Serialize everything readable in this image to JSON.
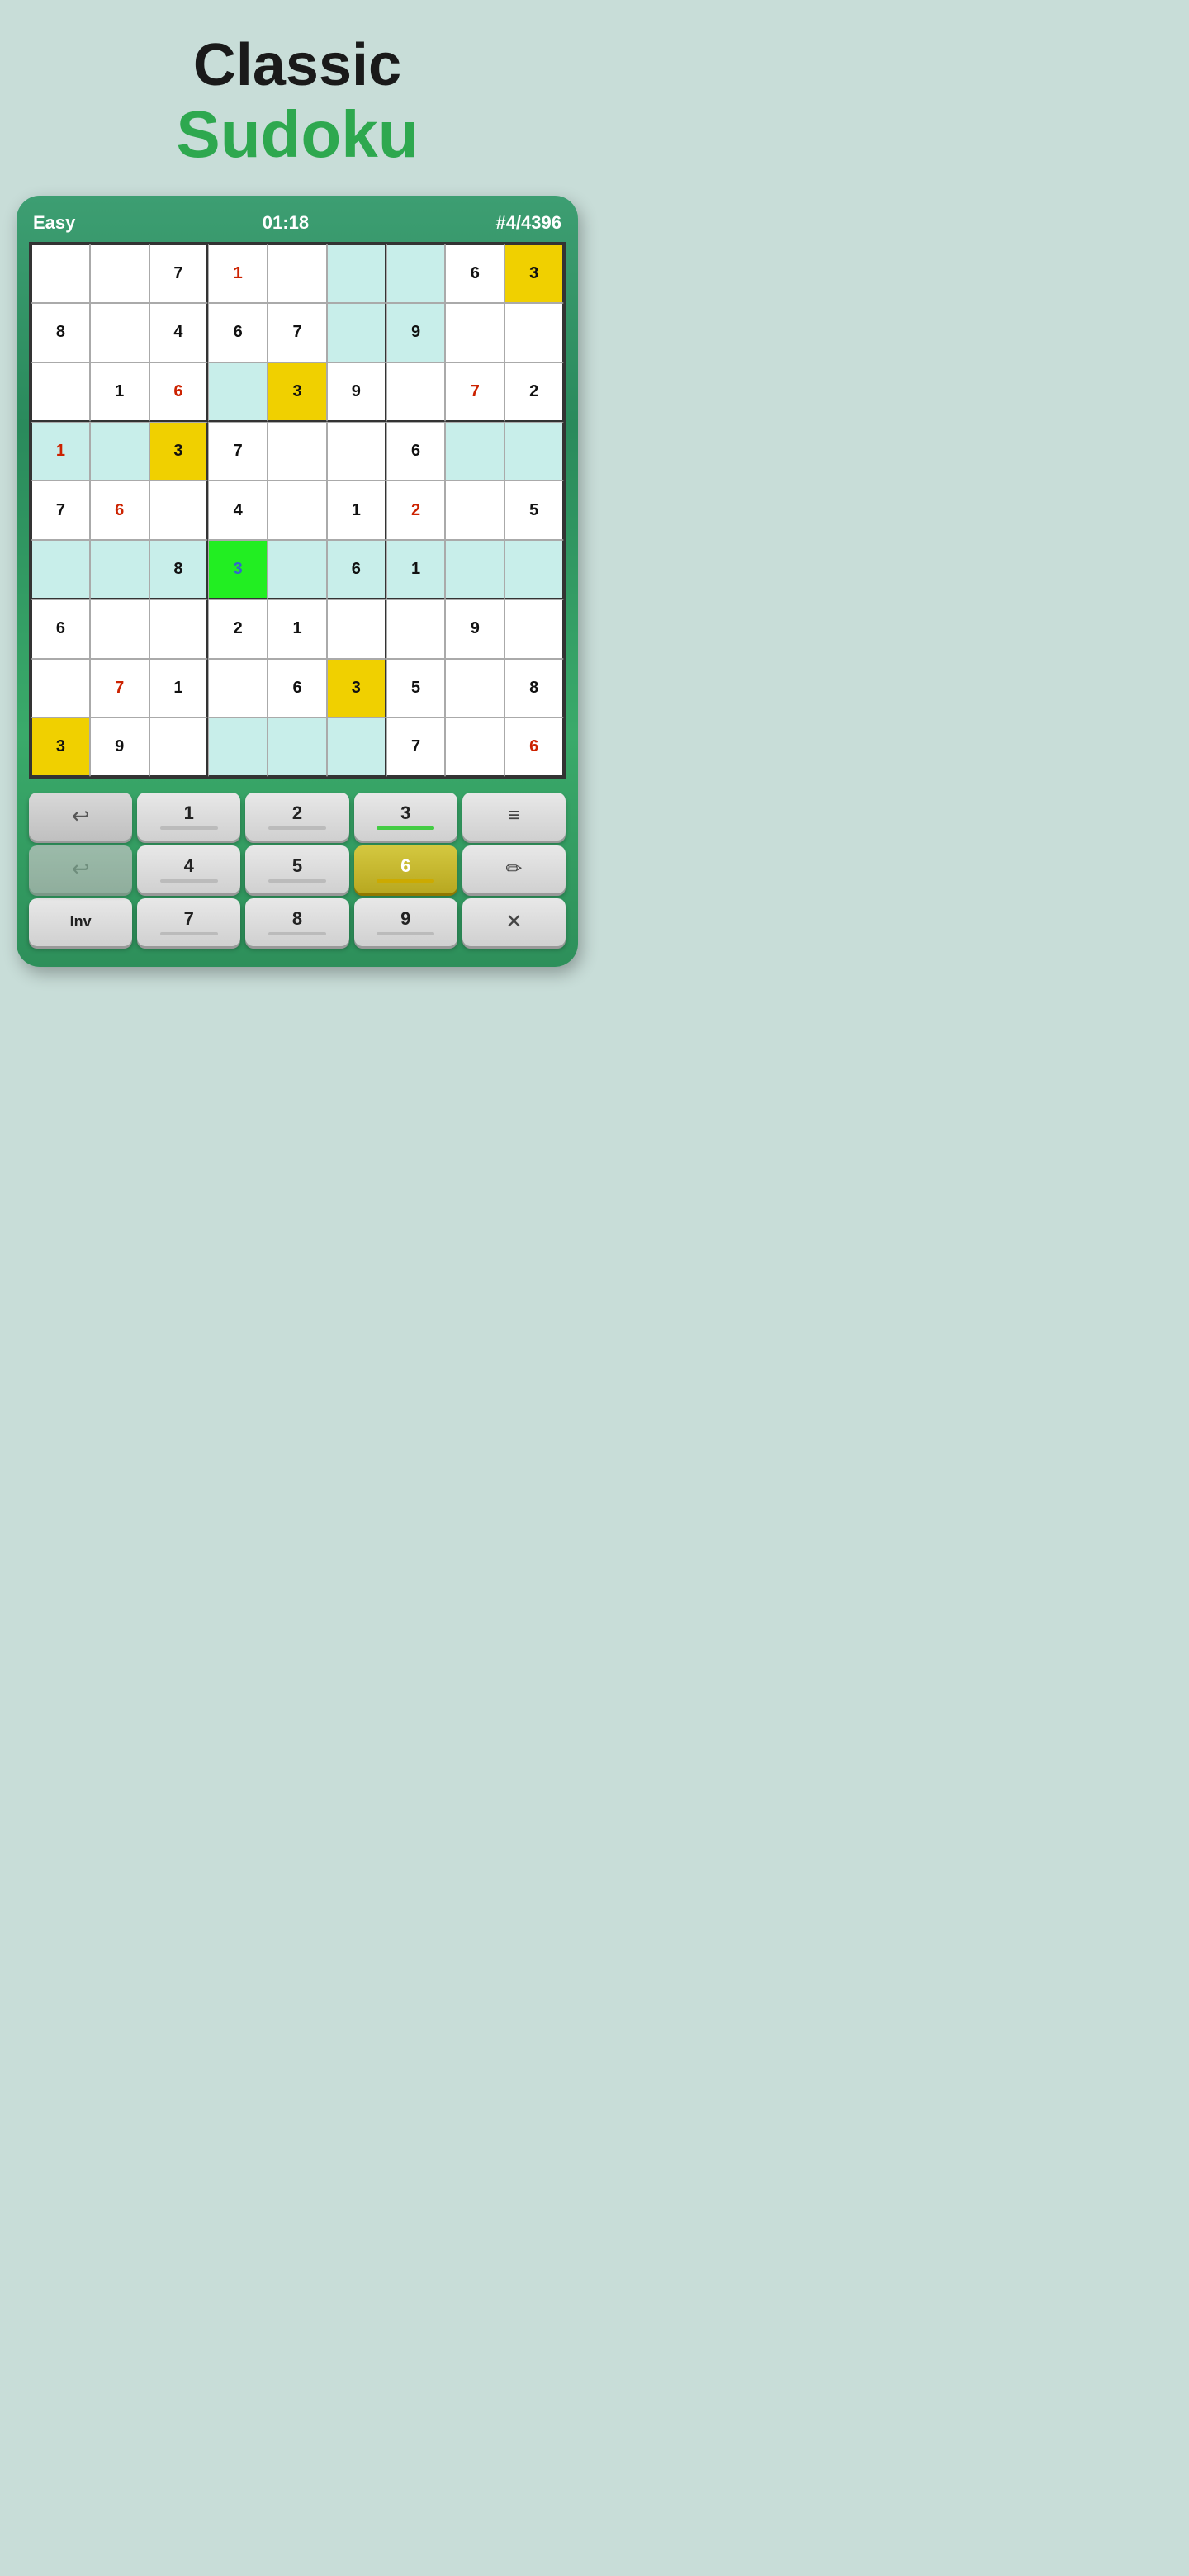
{
  "title": {
    "classic": "Classic",
    "sudoku": "Sudoku"
  },
  "header": {
    "difficulty": "Easy",
    "timer": "01:18",
    "puzzle_id": "#4/4396"
  },
  "grid": {
    "rows": [
      [
        {
          "val": "",
          "style": "white-bg",
          "color": "black"
        },
        {
          "val": "",
          "style": "white-bg",
          "color": "black"
        },
        {
          "val": "7",
          "style": "white-bg",
          "color": "black"
        },
        {
          "val": "1",
          "style": "white-bg",
          "color": "red"
        },
        {
          "val": "",
          "style": "white-bg",
          "color": "black"
        },
        {
          "val": "",
          "style": "light-teal",
          "color": "black"
        },
        {
          "val": "",
          "style": "light-teal",
          "color": "black"
        },
        {
          "val": "6",
          "style": "white-bg",
          "color": "black"
        },
        {
          "val": "3",
          "style": "yellow-bg",
          "color": "black"
        }
      ],
      [
        {
          "val": "8",
          "style": "white-bg",
          "color": "black"
        },
        {
          "val": "",
          "style": "white-bg",
          "color": "black"
        },
        {
          "val": "4",
          "style": "white-bg",
          "color": "black"
        },
        {
          "val": "6",
          "style": "white-bg",
          "color": "black"
        },
        {
          "val": "7",
          "style": "white-bg",
          "color": "black"
        },
        {
          "val": "",
          "style": "light-teal",
          "color": "black"
        },
        {
          "val": "9",
          "style": "light-teal",
          "color": "black"
        },
        {
          "val": "",
          "style": "white-bg",
          "color": "black"
        },
        {
          "val": "",
          "style": "white-bg",
          "color": "black"
        }
      ],
      [
        {
          "val": "",
          "style": "white-bg",
          "color": "black"
        },
        {
          "val": "1",
          "style": "white-bg",
          "color": "black"
        },
        {
          "val": "6",
          "style": "white-bg",
          "color": "red"
        },
        {
          "val": "",
          "style": "light-teal",
          "color": "black"
        },
        {
          "val": "3",
          "style": "yellow-bg",
          "color": "black"
        },
        {
          "val": "9",
          "style": "white-bg",
          "color": "black"
        },
        {
          "val": "",
          "style": "white-bg",
          "color": "black"
        },
        {
          "val": "7",
          "style": "white-bg",
          "color": "red"
        },
        {
          "val": "2",
          "style": "white-bg",
          "color": "black"
        }
      ],
      [
        {
          "val": "1",
          "style": "light-teal",
          "color": "red"
        },
        {
          "val": "",
          "style": "light-teal",
          "color": "black"
        },
        {
          "val": "3",
          "style": "yellow-bg",
          "color": "black"
        },
        {
          "val": "7",
          "style": "white-bg",
          "color": "black"
        },
        {
          "val": "",
          "style": "white-bg",
          "color": "black"
        },
        {
          "val": "",
          "style": "white-bg",
          "color": "black"
        },
        {
          "val": "6",
          "style": "white-bg",
          "color": "black"
        },
        {
          "val": "",
          "style": "light-teal",
          "color": "black"
        },
        {
          "val": "",
          "style": "light-teal",
          "color": "black"
        }
      ],
      [
        {
          "val": "7",
          "style": "white-bg",
          "color": "black"
        },
        {
          "val": "6",
          "style": "white-bg",
          "color": "red"
        },
        {
          "val": "",
          "style": "white-bg",
          "color": "black"
        },
        {
          "val": "4",
          "style": "white-bg",
          "color": "black"
        },
        {
          "val": "",
          "style": "white-bg",
          "color": "black"
        },
        {
          "val": "1",
          "style": "white-bg",
          "color": "black"
        },
        {
          "val": "2",
          "style": "white-bg",
          "color": "red"
        },
        {
          "val": "",
          "style": "white-bg",
          "color": "black"
        },
        {
          "val": "5",
          "style": "white-bg",
          "color": "black"
        }
      ],
      [
        {
          "val": "",
          "style": "light-teal",
          "color": "black"
        },
        {
          "val": "",
          "style": "light-teal",
          "color": "black"
        },
        {
          "val": "8",
          "style": "light-teal",
          "color": "black"
        },
        {
          "val": "3",
          "style": "green-bg",
          "color": "blue"
        },
        {
          "val": "",
          "style": "light-teal",
          "color": "black"
        },
        {
          "val": "6",
          "style": "light-teal",
          "color": "black"
        },
        {
          "val": "1",
          "style": "light-teal",
          "color": "black"
        },
        {
          "val": "",
          "style": "light-teal",
          "color": "black"
        },
        {
          "val": "",
          "style": "light-teal",
          "color": "black"
        }
      ],
      [
        {
          "val": "6",
          "style": "white-bg",
          "color": "black"
        },
        {
          "val": "",
          "style": "white-bg",
          "color": "black"
        },
        {
          "val": "",
          "style": "white-bg",
          "color": "black"
        },
        {
          "val": "2",
          "style": "white-bg",
          "color": "black"
        },
        {
          "val": "1",
          "style": "white-bg",
          "color": "black"
        },
        {
          "val": "",
          "style": "white-bg",
          "color": "black"
        },
        {
          "val": "",
          "style": "white-bg",
          "color": "black"
        },
        {
          "val": "9",
          "style": "white-bg",
          "color": "black"
        },
        {
          "val": "",
          "style": "white-bg",
          "color": "black"
        }
      ],
      [
        {
          "val": "",
          "style": "white-bg",
          "color": "black"
        },
        {
          "val": "7",
          "style": "white-bg",
          "color": "red"
        },
        {
          "val": "1",
          "style": "white-bg",
          "color": "black"
        },
        {
          "val": "",
          "style": "white-bg",
          "color": "black"
        },
        {
          "val": "6",
          "style": "white-bg",
          "color": "black"
        },
        {
          "val": "3",
          "style": "yellow-bg",
          "color": "black"
        },
        {
          "val": "5",
          "style": "white-bg",
          "color": "black"
        },
        {
          "val": "",
          "style": "white-bg",
          "color": "black"
        },
        {
          "val": "8",
          "style": "white-bg",
          "color": "black"
        }
      ],
      [
        {
          "val": "3",
          "style": "yellow-bg",
          "color": "black"
        },
        {
          "val": "9",
          "style": "white-bg",
          "color": "black"
        },
        {
          "val": "",
          "style": "white-bg",
          "color": "black"
        },
        {
          "val": "",
          "style": "light-teal",
          "color": "black"
        },
        {
          "val": "",
          "style": "light-teal",
          "color": "black"
        },
        {
          "val": "",
          "style": "light-teal",
          "color": "black"
        },
        {
          "val": "7",
          "style": "white-bg",
          "color": "black"
        },
        {
          "val": "",
          "style": "white-bg",
          "color": "black"
        },
        {
          "val": "6",
          "style": "white-bg",
          "color": "red"
        }
      ]
    ]
  },
  "keypad": {
    "rows": [
      [
        {
          "type": "undo",
          "label": "",
          "active": true
        },
        {
          "type": "number",
          "label": "1",
          "indicator": "empty"
        },
        {
          "type": "number",
          "label": "2",
          "indicator": "empty"
        },
        {
          "type": "number",
          "label": "3",
          "indicator": "green"
        },
        {
          "type": "menu",
          "label": "≡"
        }
      ],
      [
        {
          "type": "undo2",
          "label": "",
          "active": false
        },
        {
          "type": "number",
          "label": "4",
          "indicator": "empty"
        },
        {
          "type": "number",
          "label": "5",
          "indicator": "empty"
        },
        {
          "type": "number",
          "label": "6",
          "indicator": "yellow",
          "highlighted": true
        },
        {
          "type": "pencil",
          "label": "✎"
        }
      ],
      [
        {
          "type": "inv",
          "label": "Inv"
        },
        {
          "type": "number",
          "label": "7",
          "indicator": "empty"
        },
        {
          "type": "number",
          "label": "8",
          "indicator": "empty"
        },
        {
          "type": "number",
          "label": "9",
          "indicator": "empty"
        },
        {
          "type": "clear",
          "label": "✕"
        }
      ]
    ]
  }
}
